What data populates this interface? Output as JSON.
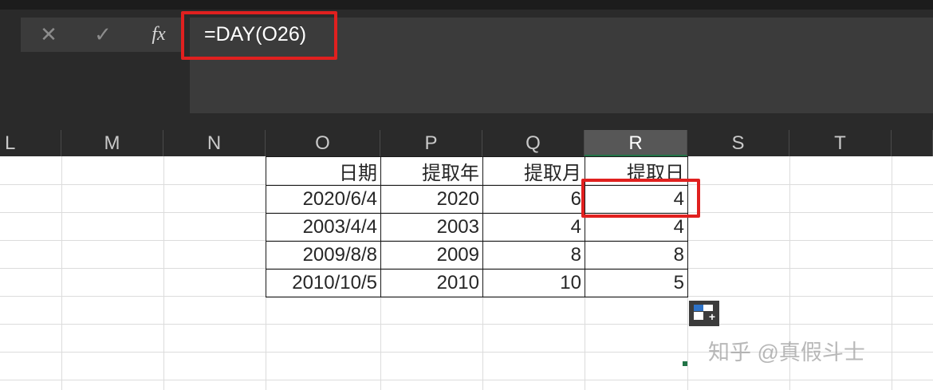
{
  "formula_bar": {
    "cancel_icon": "cross-icon",
    "cancel_glyph": "✕",
    "enter_icon": "check-icon",
    "enter_glyph": "✓",
    "fx_label": "fx",
    "formula": "=DAY(O26)"
  },
  "columns": [
    "L",
    "M",
    "N",
    "O",
    "P",
    "Q",
    "R",
    "S",
    "T"
  ],
  "active_column": "R",
  "table": {
    "headers": [
      "日期",
      "提取年",
      "提取月",
      "提取日"
    ],
    "rows": [
      [
        "2020/6/4",
        "2020",
        "6",
        "4"
      ],
      [
        "2003/4/4",
        "2003",
        "4",
        "4"
      ],
      [
        "2009/8/8",
        "2009",
        "8",
        "8"
      ],
      [
        "2010/10/5",
        "2010",
        "10",
        "5"
      ]
    ]
  },
  "quick_analysis_icon": "quick-analysis-icon",
  "watermark": "知乎 @真假斗士",
  "colors": {
    "highlight_red": "#e0201f",
    "selection_green": "#217346",
    "dark_chrome": "#2a2a2a"
  }
}
